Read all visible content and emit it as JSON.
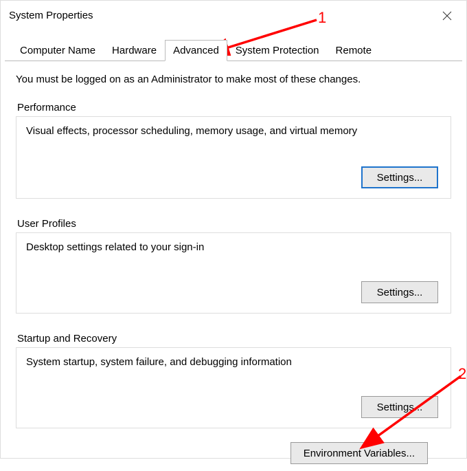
{
  "window": {
    "title": "System Properties"
  },
  "tabs": [
    {
      "label": "Computer Name"
    },
    {
      "label": "Hardware"
    },
    {
      "label": "Advanced"
    },
    {
      "label": "System Protection"
    },
    {
      "label": "Remote"
    }
  ],
  "intro": "You must be logged on as an Administrator to make most of these changes.",
  "sections": {
    "performance": {
      "label": "Performance",
      "desc": "Visual effects, processor scheduling, memory usage, and virtual memory",
      "button": "Settings..."
    },
    "userprofiles": {
      "label": "User Profiles",
      "desc": "Desktop settings related to your sign-in",
      "button": "Settings..."
    },
    "startup": {
      "label": "Startup and Recovery",
      "desc": "System startup, system failure, and debugging information",
      "button": "Settings..."
    }
  },
  "env_button": "Environment Variables...",
  "annotations": {
    "num1": "1",
    "num2": "2"
  },
  "colors": {
    "accent": "#1e73cc",
    "annotation": "#ff0000"
  }
}
